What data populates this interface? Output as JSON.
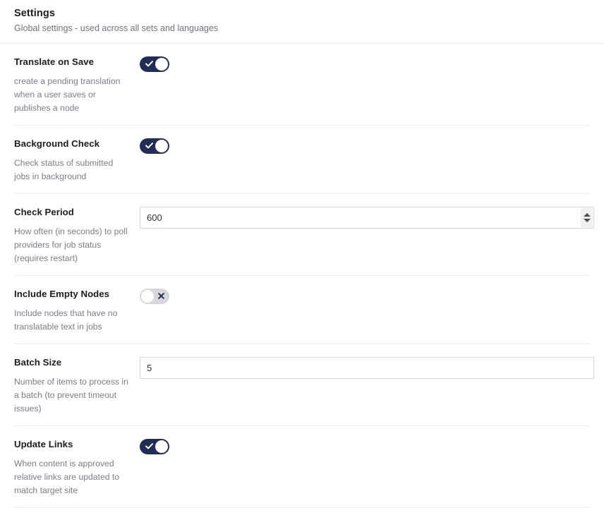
{
  "header": {
    "title": "Settings",
    "subtitle": "Global settings - used across all sets and languages"
  },
  "colors": {
    "toggle_on": "#222d56",
    "toggle_off": "#d6d7dc",
    "label_text": "#1c1c21",
    "description_text": "#7a7d89",
    "divider": "#eeeef1",
    "input_border": "#d4d4d9"
  },
  "settings": [
    {
      "label": "Translate on Save",
      "description": "create a pending translation when a user saves or publishes a node",
      "control": "toggle",
      "value": "on",
      "icon": "check-icon"
    },
    {
      "label": "Background Check",
      "description": "Check status of submitted jobs in background",
      "control": "toggle",
      "value": "on",
      "icon": "check-icon"
    },
    {
      "label": "Check Period",
      "description": "How often (in seconds) to poll providers for job status (requires restart)",
      "control": "number",
      "value": "600",
      "placeholder": "",
      "icon": "spinner-icon"
    },
    {
      "label": "Include Empty Nodes",
      "description": "Include nodes that have no translatable text in jobs",
      "control": "toggle",
      "value": "off",
      "icon": "close-icon"
    },
    {
      "label": "Batch Size",
      "description": "Number of items to process in a batch (to prevent timeout issues)",
      "control": "text",
      "value": "5",
      "placeholder": ""
    },
    {
      "label": "Update Links",
      "description": "When content is approved relative links are updated to match target site",
      "control": "toggle",
      "value": "on",
      "icon": "check-icon"
    }
  ]
}
